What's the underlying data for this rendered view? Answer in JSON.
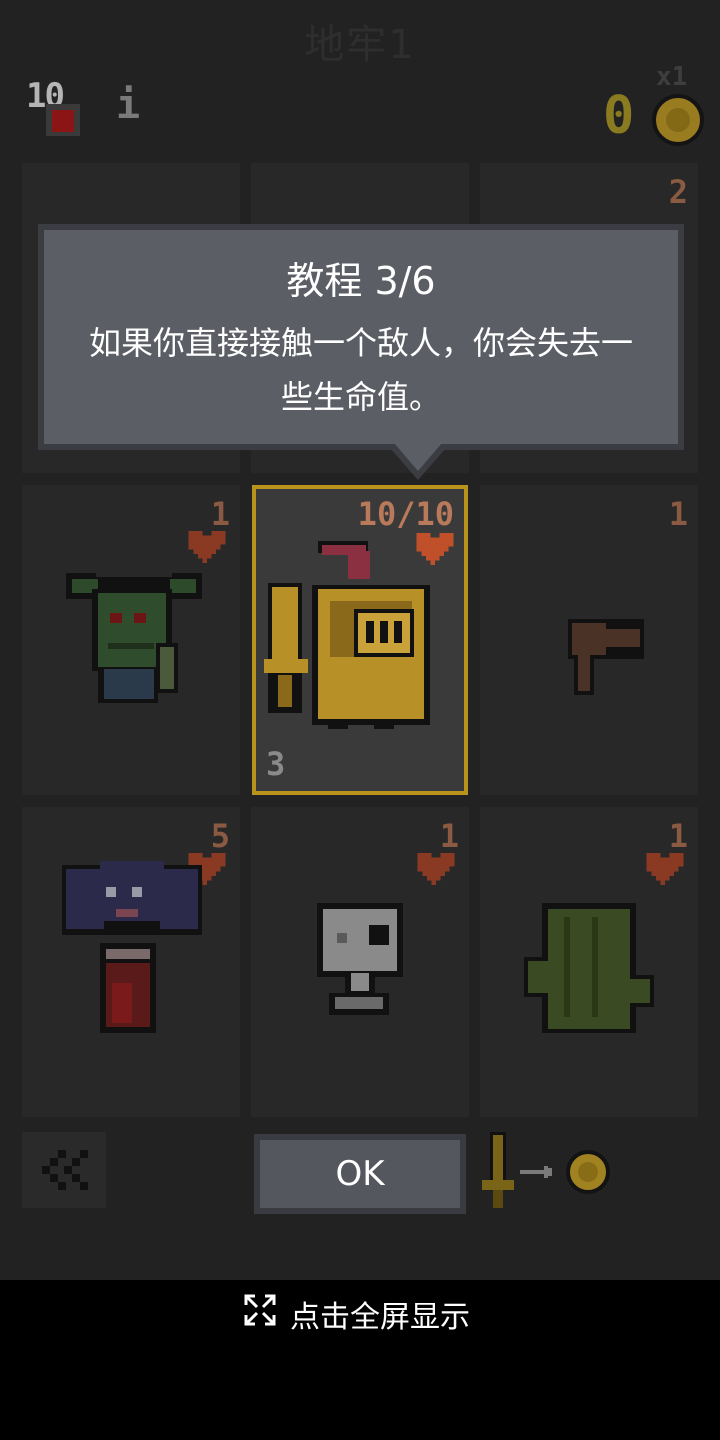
{
  "header": {
    "title": "地牢1",
    "hp_value": "10",
    "info_symbol": "i",
    "gold_count": "0",
    "gold_multiplier": "x1"
  },
  "grid": {
    "cells": [
      {
        "id": "top-left",
        "icon": "hidden-card",
        "hp": ""
      },
      {
        "id": "top-middle",
        "icon": "hidden-card",
        "hp": ""
      },
      {
        "id": "top-right",
        "icon": "hidden-card",
        "hp": "2"
      },
      {
        "id": "goblin",
        "icon": "goblin-icon",
        "hp": "1"
      },
      {
        "id": "hero",
        "icon": "knight-icon",
        "hp": "10/10",
        "weapon": "3"
      },
      {
        "id": "hammer",
        "icon": "hammer-icon",
        "hp": "1"
      },
      {
        "id": "bat",
        "icon": "bat-icon",
        "hp": "5"
      },
      {
        "id": "skeleton",
        "icon": "skull-icon",
        "hp": "1"
      },
      {
        "id": "cactus",
        "icon": "cactus-icon",
        "hp": "1"
      }
    ]
  },
  "tutorial": {
    "title": "教程 3/6",
    "body": "如果你直接接触一个敌人，你会失去一些生命值。"
  },
  "controls": {
    "back_label": "<<",
    "ok_label": "OK"
  },
  "fullscreen": {
    "label": "点击全屏显示"
  },
  "colors": {
    "background": "#222222",
    "hero_border": "#b9941c",
    "heart": "#d9542b",
    "gold": "#b89320"
  }
}
